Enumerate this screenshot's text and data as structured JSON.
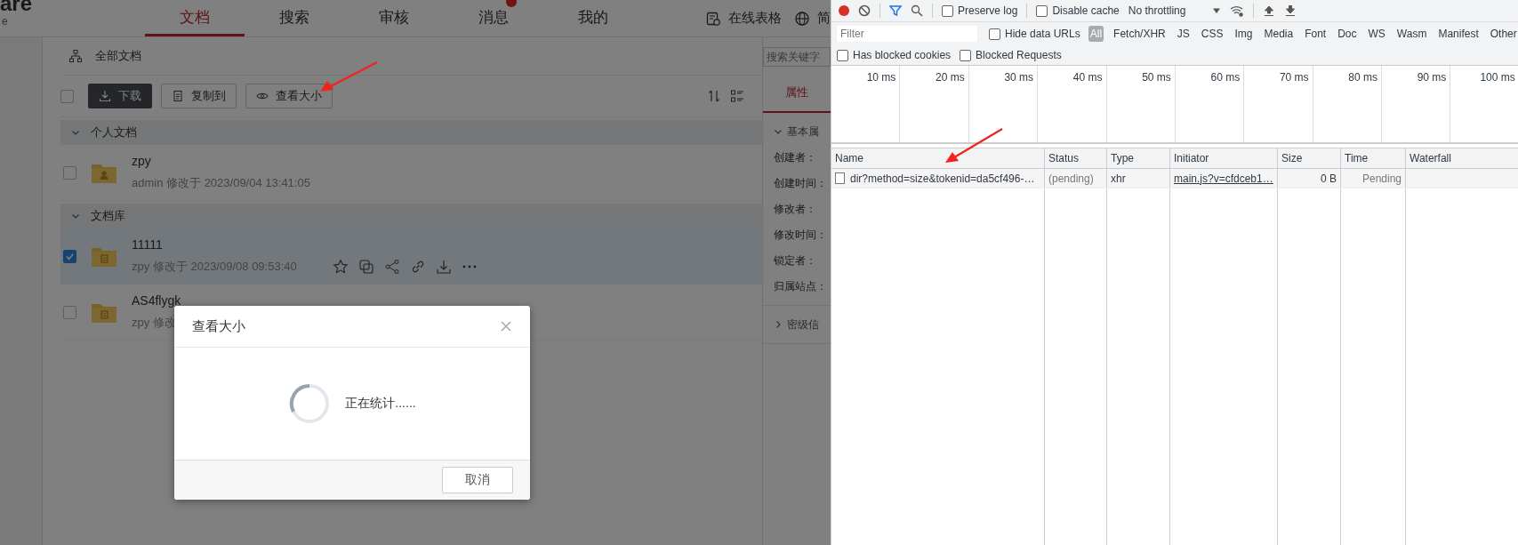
{
  "app": {
    "logo": {
      "title": "are",
      "subtitle": "e"
    },
    "nav_tabs": [
      {
        "label": "文档",
        "selected": true,
        "badge": false
      },
      {
        "label": "搜索",
        "selected": false,
        "badge": false
      },
      {
        "label": "审核",
        "selected": false,
        "badge": false
      },
      {
        "label": "消息",
        "selected": false,
        "badge": true
      },
      {
        "label": "我的",
        "selected": false,
        "badge": false
      }
    ],
    "top_links": [
      {
        "label": "在线表格",
        "kind": "sheet"
      },
      {
        "label": "简",
        "kind": "globe"
      }
    ],
    "breadcrumb": "全部文档",
    "search": {
      "placeholder": "搜索关键字"
    },
    "toolbar": {
      "select_all_checked": false,
      "buttons": [
        {
          "label": "下载",
          "kind": "primary"
        },
        {
          "label": "复制到",
          "kind": "copy"
        },
        {
          "label": "查看大小",
          "kind": "view"
        }
      ]
    },
    "groups": [
      {
        "title": "个人文档",
        "expanded": true,
        "items": [
          {
            "name": "zpy",
            "meta": "admin 修改于 2023/09/04 13:41:05",
            "checked": false,
            "selected": false,
            "kind": "personal"
          }
        ]
      },
      {
        "title": "文档库",
        "expanded": true,
        "items": [
          {
            "name": "11111",
            "meta": "zpy 修改于 2023/09/08 09:53:40",
            "checked": true,
            "selected": true,
            "kind": "library"
          },
          {
            "name": "AS4flygk",
            "meta": "zpy 修改",
            "checked": false,
            "selected": false,
            "kind": "library"
          }
        ]
      }
    ],
    "properties": {
      "tab": {
        "label": "属性",
        "selected": true
      },
      "sections": [
        {
          "title": "基本属",
          "expanded": true,
          "fields": [
            "创建者：",
            "创建时间：",
            "修改者：",
            "修改时间：",
            "锁定者：",
            "归属站点："
          ]
        },
        {
          "title": "密级信",
          "expanded": false
        }
      ]
    }
  },
  "dialog": {
    "title": "查看大小",
    "message": "正在统计......",
    "cancel": "取消"
  },
  "devtools": {
    "recording": true,
    "preserve_log": {
      "label": "Preserve log",
      "checked": false
    },
    "disable_cache": {
      "label": "Disable cache",
      "checked": false
    },
    "throttling": "No throttling",
    "filter": {
      "placeholder": "Filter"
    },
    "hide_data_urls": {
      "label": "Hide data URLs",
      "checked": false
    },
    "type_filters": [
      {
        "label": "All",
        "selected": true
      },
      {
        "label": "Fetch/XHR",
        "selected": false
      },
      {
        "label": "JS",
        "selected": false
      },
      {
        "label": "CSS",
        "selected": false
      },
      {
        "label": "Img",
        "selected": false
      },
      {
        "label": "Media",
        "selected": false
      },
      {
        "label": "Font",
        "selected": false
      },
      {
        "label": "Doc",
        "selected": false
      },
      {
        "label": "WS",
        "selected": false
      },
      {
        "label": "Wasm",
        "selected": false
      },
      {
        "label": "Manifest",
        "selected": false
      },
      {
        "label": "Other",
        "selected": false
      }
    ],
    "blocked_cookies": {
      "label": "Has blocked cookies",
      "checked": false
    },
    "blocked_requests": {
      "label": "Blocked Requests",
      "checked": false
    },
    "timeline_ticks": [
      "10 ms",
      "20 ms",
      "30 ms",
      "40 ms",
      "50 ms",
      "60 ms",
      "70 ms",
      "80 ms",
      "90 ms",
      "100 ms"
    ],
    "columns": [
      "Name",
      "Status",
      "Type",
      "Initiator",
      "Size",
      "Time",
      "Waterfall"
    ],
    "rows": [
      {
        "name": "dir?method=size&tokenid=da5cf496-…",
        "status": "(pending)",
        "type": "xhr",
        "initiator": "main.js?v=cfdceb1…",
        "size": "0 B",
        "time": "Pending"
      }
    ]
  }
}
